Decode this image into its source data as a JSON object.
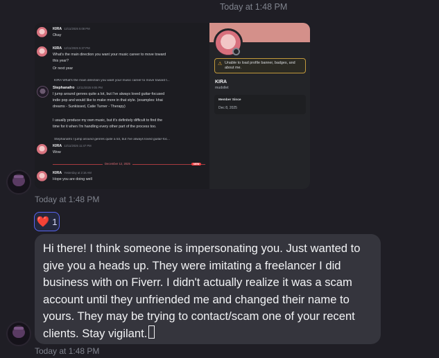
{
  "timestamp_top": "Today at 1:48 PM",
  "timestamp_1": "Today at 1:48 PM",
  "timestamp_2": "Today at 1:48 PM",
  "screenshot": {
    "messages": [
      {
        "author": "KIRA",
        "time": "12/11/2025 5:08 PM",
        "lines": [
          "Okay"
        ]
      },
      {
        "author": "KIRA",
        "time": "12/11/2025 5:37 PM",
        "lines": [
          "What's the main direction you want your music career to move toward",
          "this year?",
          "Or next year"
        ]
      },
      {
        "reply": "KIRA What's the main direction you want your music career to move toward t...",
        "author": "Stephanafro",
        "time": "12/11/2025 9:05 PM",
        "lines": [
          "I jump around genres quite a lot, but I've always loved guitar-focused",
          "indie pop and would like to make more in that style. (examples: khai",
          "dreams - Sunkissed, Catie Turner - Therapy)",
          "",
          "I usually produce my own music, but it's definitely difficult to find the",
          "time for it when I'm handling every other part of the process too."
        ]
      },
      {
        "reply": "Stephanafro I jump around genres quite a lot, but I've always loved guitar-foc...",
        "author": "KIRA",
        "time": "12/11/2025 11:47 PM",
        "lines": [
          "Wow"
        ]
      },
      {
        "author": "KIRA",
        "time": "Yesterday at 2:16 AM",
        "lines": [
          "Hope you are doing well"
        ]
      }
    ],
    "divider_label": "December 12, 2025",
    "new_badge": "NEW",
    "profile": {
      "warning": "Unable to load profile banner, badges, and about me.",
      "name": "KIRA",
      "username": "mudollet",
      "member_since_label": "Member Since",
      "member_since": "Dec 8, 2025"
    }
  },
  "reaction": {
    "emoji": "❤️",
    "count": "1"
  },
  "message": "Hi there! I think someone is impersonating you. Just wanted to give you a heads up. They were imitating a freelancer I did business with on Fiverr. I didn't actually realize it was a scam account until they unfriended me and changed their name to yours. They may be trying to contact/scam one of your recent clients. Stay vigilant."
}
